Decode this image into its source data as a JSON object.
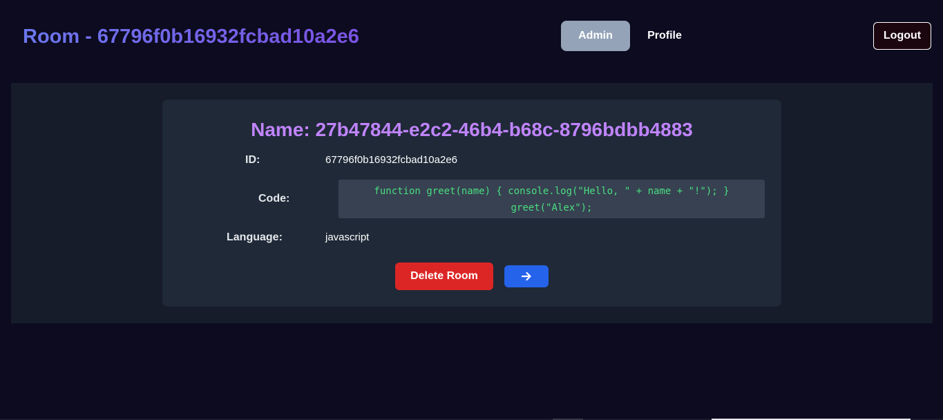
{
  "header": {
    "title": "Room - 67796f0b16932fcbad10a2e6",
    "nav": {
      "admin_label": "Admin",
      "profile_label": "Profile"
    },
    "logout_label": "Logout"
  },
  "room": {
    "name": "Name: 27b47844-e2c2-46b4-b68c-8796bdbb4883",
    "fields": {
      "id_label": "ID:",
      "id_value": "67796f0b16932fcbad10a2e6",
      "code_label": "Code:",
      "code_lines": [
        "function greet(name) { console.log(\"Hello, \" + name + \"!\"); }",
        "greet(\"Alex\");"
      ],
      "language_label": "Language:",
      "language_value": "javascript"
    },
    "actions": {
      "delete_label": "Delete Room",
      "go_icon": "arrow-right-icon"
    }
  },
  "colors": {
    "background": "#0c0b20",
    "title_gradient_start": "#6b77ee",
    "title_gradient_end": "#7b53e3",
    "card": "#1f2937",
    "room_name": "#c084fc",
    "code_text": "#4ade80",
    "delete": "#dc2626",
    "go": "#2563eb",
    "admin_active": "#94a3b8"
  }
}
